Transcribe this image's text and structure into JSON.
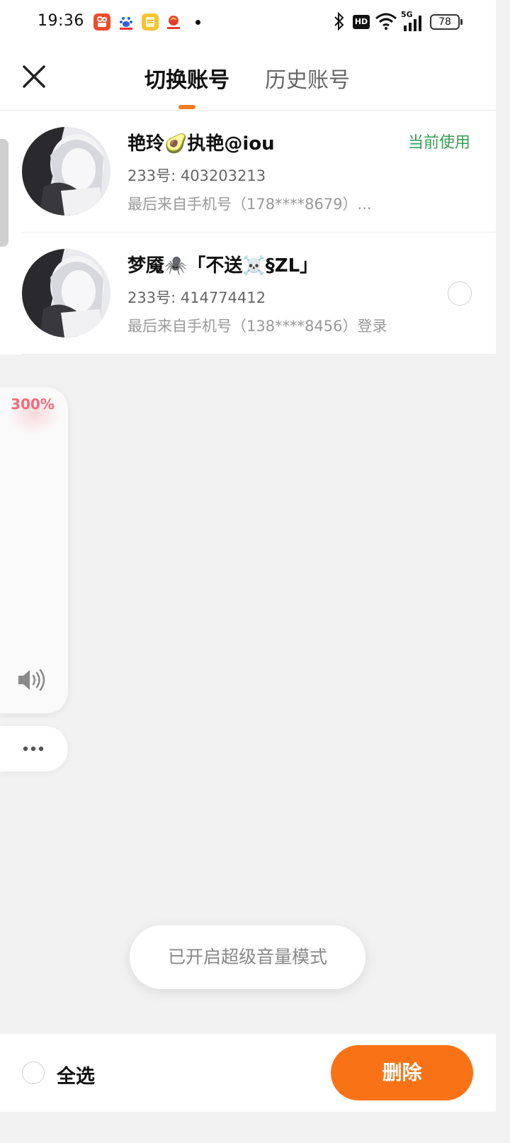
{
  "status_bar": {
    "time": "19:36",
    "battery": "78",
    "network": "5G",
    "hd_label": "HD"
  },
  "header": {
    "tabs": [
      {
        "label": "切换账号",
        "active": true
      },
      {
        "label": "历史账号",
        "active": false
      }
    ]
  },
  "accounts": [
    {
      "name": "艳玲🥑执艳@iou",
      "id_text": "233号: 403203213",
      "last_login": "最后来自手机号（178****8679）...",
      "badge": "当前使用",
      "selected": false
    },
    {
      "name": "梦魇🕷️「不送☠️§ZL」",
      "id_text": "233号: 414774412",
      "last_login": "最后来自手机号（138****8456）登录",
      "badge": "",
      "selected": false
    }
  ],
  "volume_overlay": {
    "level": "300%",
    "icon": "speaker-icon",
    "more_icon": "more-dots-icon"
  },
  "toast": "已开启超级音量模式",
  "bottom": {
    "select_all": "全选",
    "delete": "删除"
  },
  "colors": {
    "accent": "#f97316",
    "current_badge": "#3b9b55",
    "volume_level": "#ef6d7d"
  }
}
